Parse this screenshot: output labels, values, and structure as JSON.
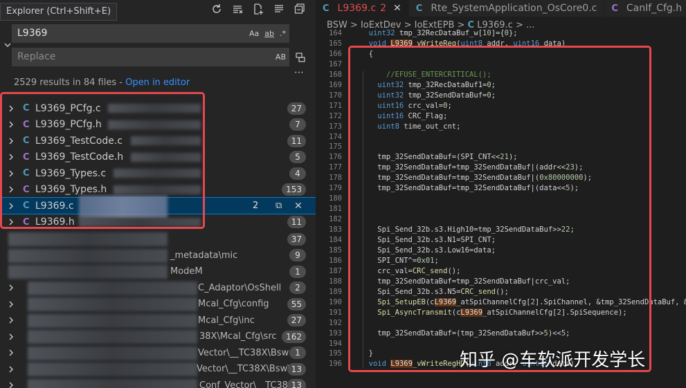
{
  "explorer": {
    "tooltip": "Explorer (Ctrl+Shift+E)",
    "search_value": "L9369",
    "search_opts": [
      "Aa",
      "ab",
      ".*"
    ],
    "replace_placeholder": "Replace",
    "replace_opt": "AB",
    "summary": "2529 results in 84 files - ",
    "open_in_editor": "Open in editor",
    "results": [
      {
        "icon": "C",
        "type": "c",
        "name": "L9369_PCfg.c",
        "count": "27"
      },
      {
        "icon": "C",
        "type": "h",
        "name": "L9369_PCfg.h",
        "count": "7"
      },
      {
        "icon": "C",
        "type": "c",
        "name": "L9369_TestCode.c",
        "count": "11"
      },
      {
        "icon": "C",
        "type": "h",
        "name": "L9369_TestCode.h",
        "count": "5"
      },
      {
        "icon": "C",
        "type": "c",
        "name": "L9369_Types.c",
        "count": "4"
      },
      {
        "icon": "C",
        "type": "h",
        "name": "L9369_Types.h",
        "count": "153"
      },
      {
        "icon": "C",
        "type": "c",
        "name": "L9369.c",
        "count": "2",
        "selected": true
      },
      {
        "icon": "C",
        "type": "h",
        "name": "L9369.h",
        "count": "11"
      }
    ],
    "blurred_rows": [
      {
        "path": "",
        "count": "37"
      },
      {
        "path": "_metadata\\mic",
        "count": "9"
      },
      {
        "path": "ModeM",
        "count": "1"
      },
      {
        "path": "C_Adaptor\\OsShell",
        "count": "2"
      },
      {
        "path": "Mcal_Cfg\\config",
        "count": "55"
      },
      {
        "path": "Mcal_Cfg\\inc",
        "count": "27"
      },
      {
        "path": "38X\\Mcal_Cfg\\src",
        "count": "162"
      },
      {
        "path": "Vector\\__TC38X\\Bsw",
        "count": "1"
      },
      {
        "path": "Vector\\__TC38X\\Bsw\\...",
        "count": "13"
      },
      {
        "path": "Conf_Vector\\__TC38X...",
        "count": "13"
      }
    ]
  },
  "editor": {
    "tabs": [
      {
        "icon": "C",
        "label": "L9369.c",
        "modified": "2",
        "active": true
      },
      {
        "icon": "C",
        "label": "Rte_SystemApplication_OsCore0.c"
      },
      {
        "icon": "C",
        "label": "CanIf_Cfg.h"
      }
    ],
    "breadcrumbs": "BSW > IoExtDev > IoExtEPB > ",
    "breadcrumb_file_icon": "C",
    "breadcrumb_file": "L9369.c > ...",
    "lines": [
      {
        "n": "164",
        "t": "  uint32 tmp_32RecDataBuf_w[10]={0};"
      },
      {
        "n": "165",
        "t": "  void L9369_vWriteReg(uint8 addr, uint16 data)"
      },
      {
        "n": "166",
        "t": "  {"
      },
      {
        "n": "167",
        "t": ""
      },
      {
        "n": "168",
        "t": "      //EFUSE_ENTERCRITICAL();"
      },
      {
        "n": "169",
        "t": "    uint32 tmp_32RecDataBuf1=0;"
      },
      {
        "n": "170",
        "t": "    uint32 tmp_32SendDataBuf=0;"
      },
      {
        "n": "171",
        "t": "    uint16 crc_val=0;"
      },
      {
        "n": "172",
        "t": "    uint16 CRC_Flag;"
      },
      {
        "n": "173",
        "t": "    uint8 time_out_cnt;"
      },
      {
        "n": "174",
        "t": ""
      },
      {
        "n": "175",
        "t": ""
      },
      {
        "n": "176",
        "t": "    tmp_32SendDataBuf=(SPI_CNT<<21);"
      },
      {
        "n": "177",
        "t": "    tmp_32SendDataBuf=tmp_32SendDataBuf|(addr<<23);"
      },
      {
        "n": "178",
        "t": "    tmp_32SendDataBuf=tmp_32SendDataBuf|(0x80000000);"
      },
      {
        "n": "179",
        "t": "    tmp_32SendDataBuf=tmp_32SendDataBuf|(data<<5);"
      },
      {
        "n": "180",
        "t": ""
      },
      {
        "n": "181",
        "t": ""
      },
      {
        "n": "182",
        "t": ""
      },
      {
        "n": "183",
        "t": "    Spi_Send_32b.s3.High10=tmp_32SendDataBuf>>22;"
      },
      {
        "n": "184",
        "t": "    Spi_Send_32b.s3.N1=SPI_CNT;"
      },
      {
        "n": "185",
        "t": "    Spi_Send_32b.s3.Low16=data;"
      },
      {
        "n": "186",
        "t": "    SPI_CNT^=0x01;"
      },
      {
        "n": "187",
        "t": "    crc_val=CRC_send();"
      },
      {
        "n": "188",
        "t": "    tmp_32SendDataBuf=tmp_32SendDataBuf|crc_val;"
      },
      {
        "n": "189",
        "t": "    Spi_Send_32b.s3.N5=CRC_send();"
      },
      {
        "n": "190",
        "t": "    Spi_SetupEB(cL9369_atSpiChannelCfg[2].SpiChannel, &tmp_32SendDataBuf, &tmp_3"
      },
      {
        "n": "191",
        "t": "    Spi_AsyncTransmit(cL9369_atSpiChannelCfg[2].SpiSequence);"
      },
      {
        "n": "192",
        "t": ""
      },
      {
        "n": "193",
        "t": "    tmp_32SendDataBuf=(tmp_32SendDataBuf>>5)<<5;"
      },
      {
        "n": "194",
        "t": ""
      },
      {
        "n": "195",
        "t": "  }"
      },
      {
        "n": "196",
        "t": "  void L9369_vWriteRegHD(uint8 addr, uint16 data)"
      }
    ]
  },
  "watermark": "知乎 @车软派开发学长",
  "colors": {
    "accent_red": "#e5484d",
    "c_icon": "#519aba",
    "h_icon": "#a074c4",
    "selection": "#04395e"
  }
}
